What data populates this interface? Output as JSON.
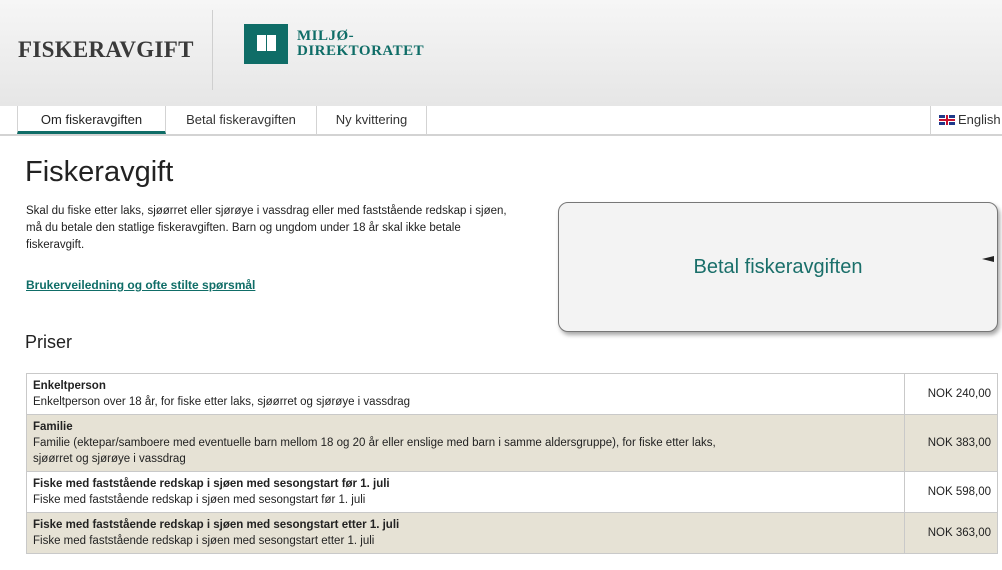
{
  "header": {
    "site_title": "FISKERAVGIFT",
    "logo_line1": "MILJØ-",
    "logo_line2": "DIREKTORATET"
  },
  "nav": {
    "tabs": [
      {
        "label": "Om fiskeravgiften",
        "active": true
      },
      {
        "label": "Betal fiskeravgiften",
        "active": false
      },
      {
        "label": "Ny kvittering",
        "active": false
      }
    ],
    "language": "English"
  },
  "main": {
    "title": "Fiskeravgift",
    "intro": "Skal du fiske etter laks, sjøørret eller sjørøye i vassdrag eller med faststående redskap i sjøen, må du betale den statlige fiskeravgiften. Barn og ungdom under 18 år skal ikke betale fiskeravgift.",
    "help_link": "Brukerveiledning og ofte stilte spørsmål",
    "cta_label": "Betal fiskeravgiften"
  },
  "prices": {
    "title": "Priser",
    "rows": [
      {
        "title": "Enkeltperson",
        "description": "Enkeltperson over 18 år, for fiske etter laks, sjøørret og sjørøye i vassdrag",
        "price": "NOK 240,00"
      },
      {
        "title": "Familie",
        "description": "Familie (ektepar/samboere med eventuelle barn mellom 18 og 20 år eller enslige med barn i samme aldersgruppe), for fiske etter laks, sjøørret og sjørøye i vassdrag",
        "price": "NOK 383,00"
      },
      {
        "title": "Fiske med faststående redskap i sjøen med sesongstart før 1. juli",
        "description": "Fiske med faststående redskap i sjøen med sesongstart før 1. juli",
        "price": "NOK 598,00"
      },
      {
        "title": "Fiske med faststående redskap i sjøen med sesongstart etter 1. juli",
        "description": "Fiske med faststående redskap i sjøen med sesongstart etter 1. juli",
        "price": "NOK 363,00"
      }
    ]
  },
  "colors": {
    "brand": "#0f6d67",
    "row_alt": "#e6e2d5"
  }
}
